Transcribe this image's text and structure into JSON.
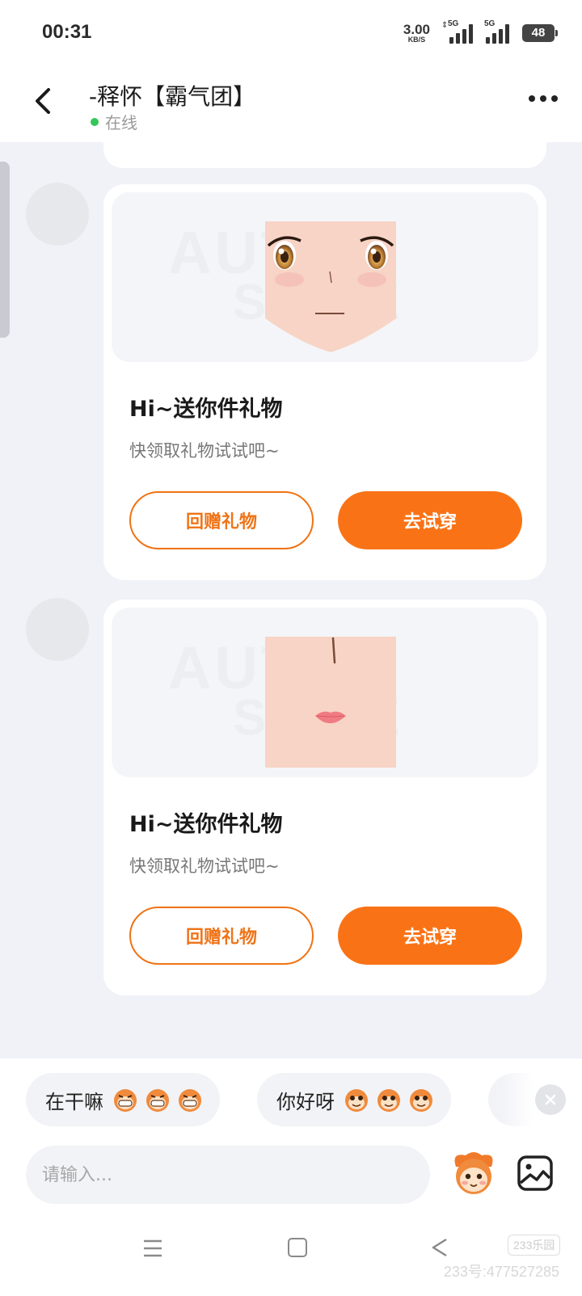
{
  "status_bar": {
    "time": "00:31",
    "net_speed": "3.00",
    "net_unit": "KB/S",
    "signal_1_label": "5G",
    "signal_2_label": "5G",
    "battery": "48"
  },
  "header": {
    "title": "-释怀【霸气团】",
    "status": "在线",
    "status_color": "#34c759"
  },
  "messages": [
    {
      "type": "gift-card",
      "preview": "anime-eyes-face",
      "title": "Hi~送你件礼物",
      "subtitle": "快领取礼物试试吧~",
      "return_label": "回赠礼物",
      "try_label": "去试穿"
    },
    {
      "type": "gift-card",
      "preview": "mouth-nose-face",
      "title": "Hi~送你件礼物",
      "subtitle": "快领取礼物试试吧~",
      "return_label": "回赠礼物",
      "try_label": "去试穿"
    }
  ],
  "preview_watermark": {
    "line1": "AUTOR",
    "line2": "SITHE"
  },
  "quick_replies": [
    {
      "text": "在干嘛",
      "emoji": "grin-monkey-emoji",
      "count": 3
    },
    {
      "text": "你好呀",
      "emoji": "smile-monkey-emoji",
      "count": 3
    }
  ],
  "input": {
    "placeholder": "请输入..."
  },
  "colors": {
    "accent": "#f97316",
    "background": "#f0f2f8"
  },
  "watermark": {
    "logo": "233乐园",
    "id": "233号:477527285"
  }
}
